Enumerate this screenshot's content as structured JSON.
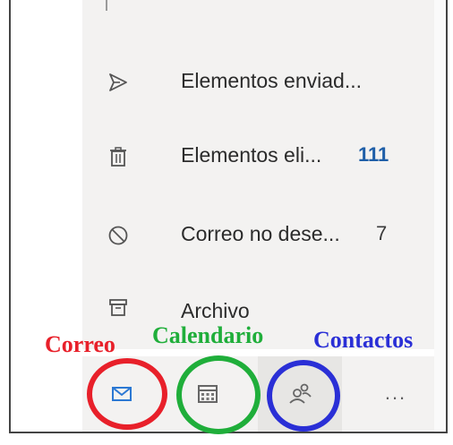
{
  "folders": [
    {
      "icon": "sent-icon",
      "label": "Elementos enviad...",
      "count": ""
    },
    {
      "icon": "trash-icon",
      "label": "Elementos eli...",
      "count": "111"
    },
    {
      "icon": "junk-icon",
      "label": "Correo no dese...",
      "count": "7"
    },
    {
      "icon": "archive-icon",
      "label": "Archivo",
      "count": ""
    }
  ],
  "annotations": {
    "mail": "Correo",
    "calendar": "Calendario",
    "contacts": "Contactos"
  },
  "nav": {
    "more": "..."
  },
  "colors": {
    "pane": "#f3f2f1",
    "mail_icon": "#2b78d3",
    "unread_count": "#1f5fa8",
    "annot_red": "#e8202a",
    "annot_green": "#1fae3a",
    "annot_blue": "#2a2fd6"
  }
}
